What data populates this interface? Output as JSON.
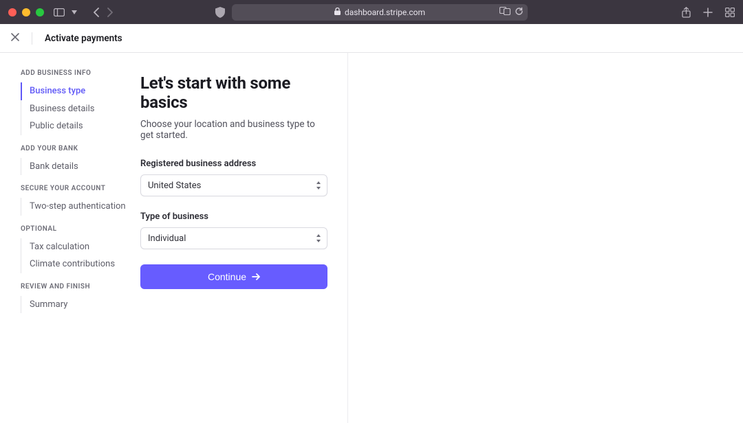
{
  "browser": {
    "url": "dashboard.stripe.com"
  },
  "header": {
    "title": "Activate payments"
  },
  "sidebar": {
    "groups": [
      {
        "heading": "ADD BUSINESS INFO",
        "items": [
          {
            "label": "Business type",
            "active": true
          },
          {
            "label": "Business details",
            "active": false
          },
          {
            "label": "Public details",
            "active": false
          }
        ]
      },
      {
        "heading": "ADD YOUR BANK",
        "items": [
          {
            "label": "Bank details",
            "active": false
          }
        ]
      },
      {
        "heading": "SECURE YOUR ACCOUNT",
        "items": [
          {
            "label": "Two-step authentication",
            "active": false
          }
        ]
      },
      {
        "heading": "OPTIONAL",
        "items": [
          {
            "label": "Tax calculation",
            "active": false
          },
          {
            "label": "Climate contributions",
            "active": false
          }
        ]
      },
      {
        "heading": "REVIEW AND FINISH",
        "items": [
          {
            "label": "Summary",
            "active": false
          }
        ]
      }
    ]
  },
  "form": {
    "title": "Let's start with some basics",
    "subtitle": "Choose your location and business type to get started.",
    "address_label": "Registered business address",
    "address_value": "United States",
    "type_label": "Type of business",
    "type_value": "Individual",
    "continue_label": "Continue"
  }
}
